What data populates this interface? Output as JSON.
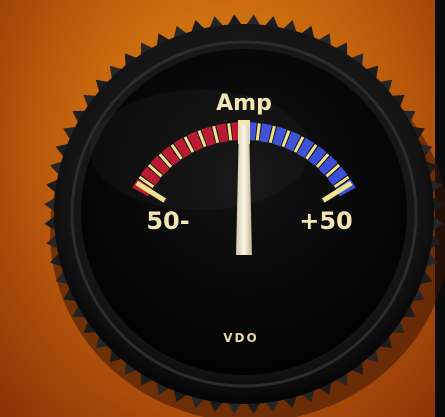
{
  "gauge": {
    "unit_label": "Amp",
    "left_scale_label": "50-",
    "right_scale_label": "+50",
    "brand_label": "VDO",
    "reading_amps": 0,
    "scale_min_amps": -50,
    "scale_max_amps": 50
  },
  "colors": {
    "background_orange": "#d4770f",
    "bezel": "#1a1a1a",
    "dial_face": "#050505",
    "negative_zone": "#b8142a",
    "positive_zone": "#3a4ed8",
    "tick_marks": "#f0e28a",
    "label_text": "#f5e6b0",
    "needle": "#f2ead2"
  },
  "icons": [
    "amp-gauge-needle",
    "knurled-bezel-ring"
  ]
}
